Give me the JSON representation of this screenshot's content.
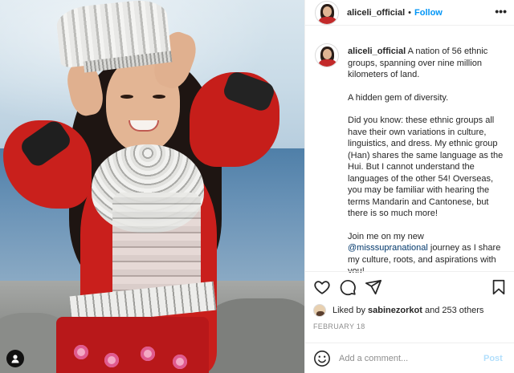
{
  "post": {
    "username": "aliceli_official",
    "follow_label": "Follow",
    "separator": "•",
    "more_label": "•••"
  },
  "caption": {
    "username": "aliceli_official",
    "intro": "A nation of 56 ethnic groups, spanning over nine million kilometers of land.",
    "p2": "A hidden gem of diversity.",
    "p3": "Did you know: these ethnic groups all have their own variations in culture, linguistics, and dress. My ethnic group (Han) shares the same language as the Hui. But I cannot understand the languages of the other 54! Overseas, you may be familiar with hearing the terms Mandarin and Cantonese, but there is so much more!",
    "p4_before": "Join me on my new ",
    "p4_mention": "@misssupranational",
    "p4_after": " journey as I share my culture, roots, and aspirations with you!"
  },
  "actions": {
    "icons": [
      "heart-icon",
      "comment-icon",
      "share-icon",
      "bookmark-icon"
    ]
  },
  "likes": {
    "prefix": "Liked by",
    "user": "sabinezorkot",
    "suffix": "and 253 others"
  },
  "date": "FEBRUARY 18",
  "comment_box": {
    "placeholder": "Add a comment...",
    "post_label": "Post"
  },
  "colors": {
    "link_blue": "#0095f6",
    "mention": "#00376b",
    "muted": "#8e8e8e",
    "dress_red": "#c91f1c"
  }
}
